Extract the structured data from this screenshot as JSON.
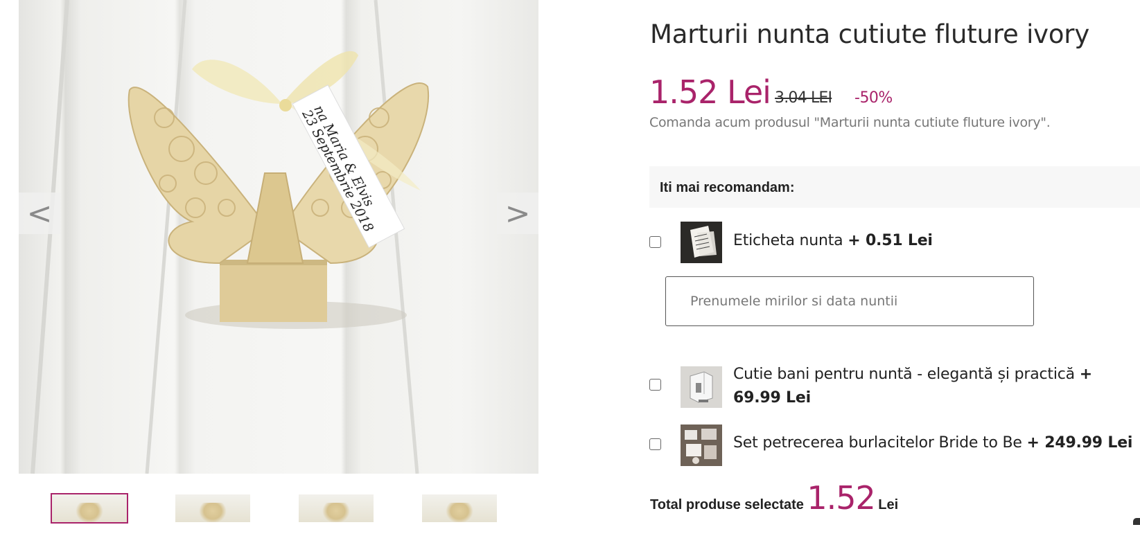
{
  "product": {
    "title": "Marturii nunta cutiute fluture ivory",
    "price": "1.52 Lei",
    "old_price": "3.04 LEI",
    "discount": "-50%",
    "order_note": "Comanda acum produsul \"Marturii nunta cutiute fluture ivory\".",
    "tag_text_line1": "na Maria & Elvis",
    "tag_text_line2": "23 Septembrie 2018"
  },
  "gallery": {
    "prev_icon": "<",
    "next_icon": ">",
    "thumbnails": [
      {
        "active": true
      },
      {
        "active": false
      },
      {
        "active": false
      },
      {
        "active": false
      }
    ]
  },
  "recommendations": {
    "header": "Iti mai recomandam:",
    "items": [
      {
        "name": "Eticheta nunta",
        "price": "+ 0.51 Lei",
        "checked": false
      },
      {
        "name": "Cutie bani pentru nuntă - elegantă și practică",
        "price": "+ 69.99 Lei",
        "checked": false
      },
      {
        "name": "Set petrecerea burlacitelor Bride to Be",
        "price": "+ 249.99 Lei",
        "checked": false
      }
    ],
    "input_placeholder": "Prenumele mirilor si data nuntii"
  },
  "total": {
    "label": "Total produse selectate",
    "value": "1.52",
    "currency": "Lei"
  },
  "colors": {
    "accent": "#a9236a",
    "text": "#222222",
    "muted": "#777777"
  }
}
